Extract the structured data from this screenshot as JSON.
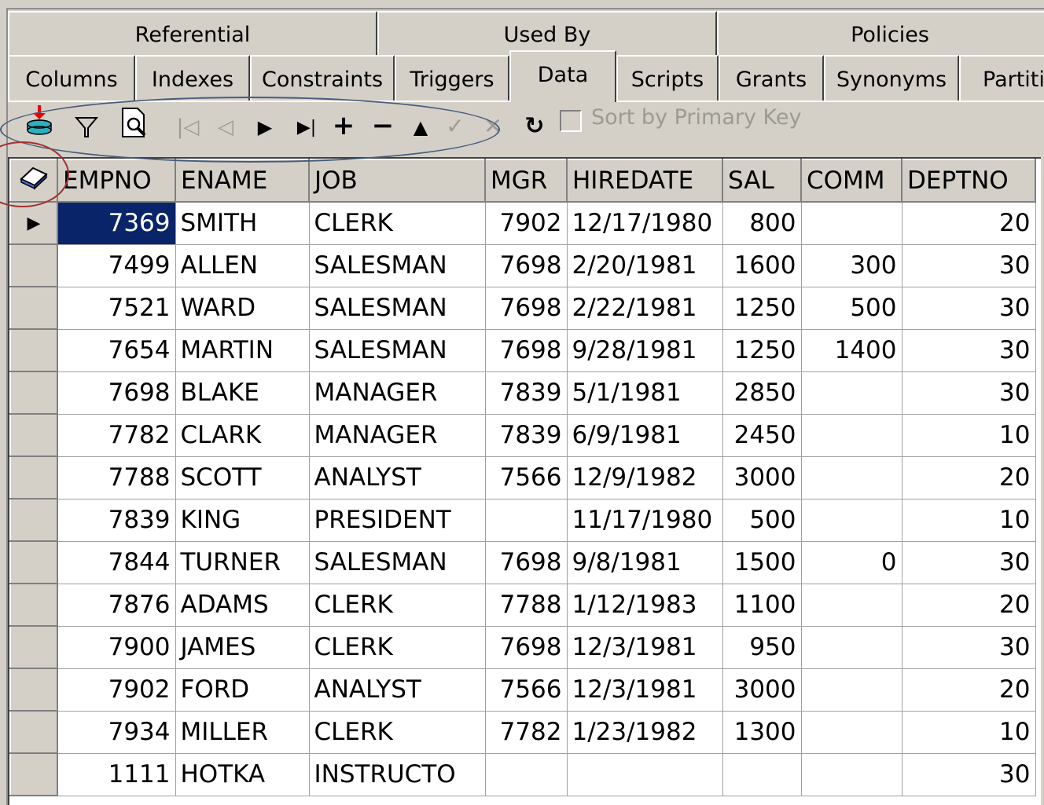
{
  "tabs_top": [
    "Referential",
    "Used By",
    "Policies"
  ],
  "tabs_bottom": [
    "Columns",
    "Indexes",
    "Constraints",
    "Triggers",
    "Data",
    "Scripts",
    "Grants",
    "Synonyms",
    "Partitio"
  ],
  "active_tab": "Data",
  "toolbar": {
    "sort_label": "Sort by Primary Key",
    "icons": [
      "import-icon",
      "filter-icon",
      "find-icon",
      "first-record-icon",
      "prior-record-icon",
      "next-record-icon",
      "last-record-icon",
      "insert-record-icon",
      "delete-record-icon",
      "edit-record-icon",
      "post-edit-icon",
      "cancel-edit-icon",
      "refresh-icon"
    ]
  },
  "grid": {
    "columns": [
      "EMPNO",
      "ENAME",
      "JOB",
      "MGR",
      "HIREDATE",
      "SAL",
      "COMM",
      "DEPTNO"
    ],
    "rows": [
      [
        "7369",
        "SMITH",
        "CLERK",
        "7902",
        "12/17/1980",
        "800",
        "",
        "20"
      ],
      [
        "7499",
        "ALLEN",
        "SALESMAN",
        "7698",
        "2/20/1981",
        "1600",
        "300",
        "30"
      ],
      [
        "7521",
        "WARD",
        "SALESMAN",
        "7698",
        "2/22/1981",
        "1250",
        "500",
        "30"
      ],
      [
        "7654",
        "MARTIN",
        "SALESMAN",
        "7698",
        "9/28/1981",
        "1250",
        "1400",
        "30"
      ],
      [
        "7698",
        "BLAKE",
        "MANAGER",
        "7839",
        "5/1/1981",
        "2850",
        "",
        "30"
      ],
      [
        "7782",
        "CLARK",
        "MANAGER",
        "7839",
        "6/9/1981",
        "2450",
        "",
        "10"
      ],
      [
        "7788",
        "SCOTT",
        "ANALYST",
        "7566",
        "12/9/1982",
        "3000",
        "",
        "20"
      ],
      [
        "7839",
        "KING",
        "PRESIDENT",
        "",
        "11/17/1980",
        "500",
        "",
        "10"
      ],
      [
        "7844",
        "TURNER",
        "SALESMAN",
        "7698",
        "9/8/1981",
        "1500",
        "0",
        "30"
      ],
      [
        "7876",
        "ADAMS",
        "CLERK",
        "7788",
        "1/12/1983",
        "1100",
        "",
        "20"
      ],
      [
        "7900",
        "JAMES",
        "CLERK",
        "7698",
        "12/3/1981",
        "950",
        "",
        "30"
      ],
      [
        "7902",
        "FORD",
        "ANALYST",
        "7566",
        "12/3/1981",
        "3000",
        "",
        "20"
      ],
      [
        "7934",
        "MILLER",
        "CLERK",
        "7782",
        "1/23/1982",
        "1300",
        "",
        "10"
      ],
      [
        "1111",
        "HOTKA",
        "INSTRUCTO",
        "",
        "",
        "",
        "",
        "30"
      ]
    ],
    "selected_row": 0,
    "selected_col": 0,
    "colors": {
      "selection": "#0a246a",
      "face": "#d4d0c8"
    }
  }
}
